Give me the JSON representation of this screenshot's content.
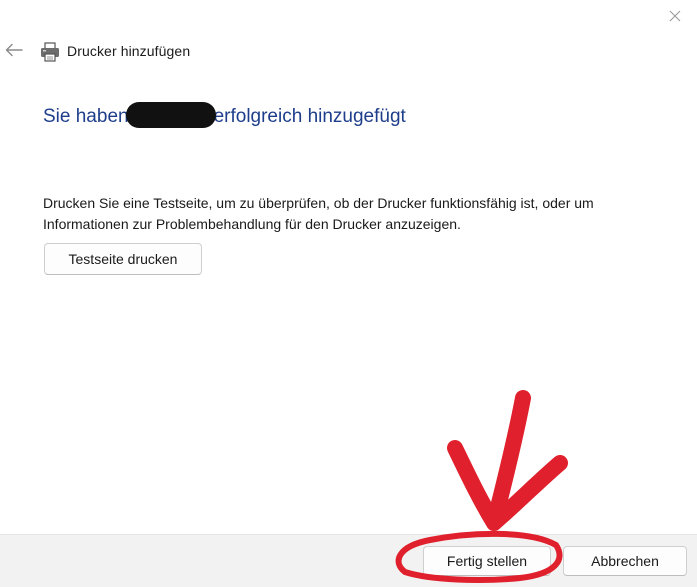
{
  "window": {
    "title": "Drucker hinzufügen"
  },
  "heading": {
    "prefix": "Sie haben",
    "suffix": "erfolgreich hinzugefügt"
  },
  "description": "Drucken Sie eine Testseite, um zu überprüfen, ob der Drucker funktionsfähig ist, oder um Informationen zur Problembehandlung für den Drucker anzuzeigen.",
  "buttons": {
    "test_print": "Testseite drucken",
    "finish": "Fertig stellen",
    "cancel": "Abbrechen"
  },
  "icons": {
    "close": "close-icon",
    "back": "back-arrow-icon",
    "printer": "printer-icon"
  },
  "colors": {
    "heading": "#1e3e8c",
    "annotation": "#e0202c",
    "footer_bg": "#f2f2f2"
  }
}
